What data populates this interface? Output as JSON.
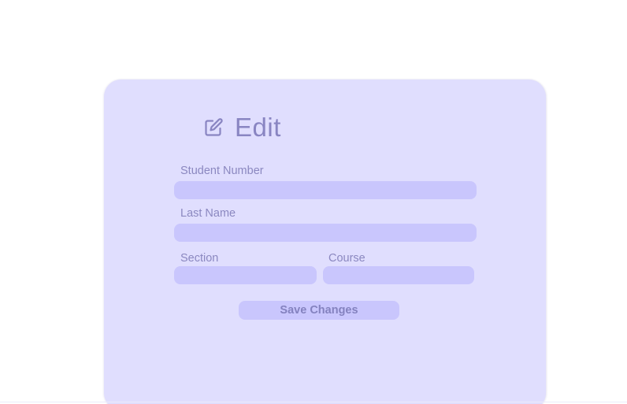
{
  "form": {
    "title": "Edit",
    "icon": "edit-icon",
    "fields": {
      "student_number": {
        "label": "Student Number",
        "value": "",
        "placeholder": ""
      },
      "last_name": {
        "label": "Last Name",
        "value": "",
        "placeholder": ""
      },
      "section": {
        "label": "Section",
        "value": "",
        "placeholder": ""
      },
      "course": {
        "label": "Course",
        "value": "",
        "placeholder": ""
      }
    },
    "save_label": "Save Changes"
  },
  "colors": {
    "card_background": "#e0defe",
    "field_background": "#c9c6fd",
    "text": "#8b88c0",
    "page_background": "#ffffff"
  }
}
